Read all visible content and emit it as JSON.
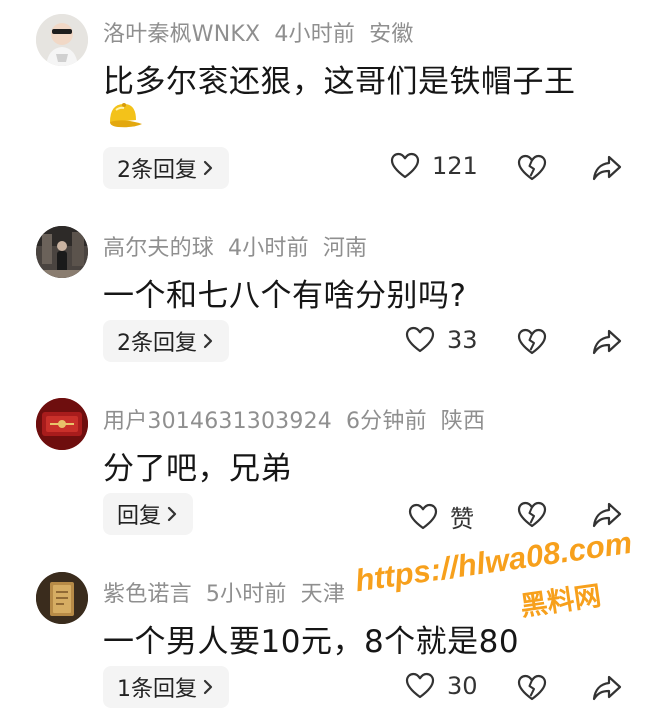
{
  "comments": [
    {
      "user": "洛叶秦枫WNKX",
      "time": "4小时前",
      "location": "安徽",
      "text": "比多尔衮还狠，这哥们是铁帽子王",
      "emoji": "cap-icon",
      "reply_label": "2条回复",
      "likes": "121"
    },
    {
      "user": "高尔夫的球",
      "time": "4小时前",
      "location": "河南",
      "text": "一个和七八个有啥分别吗?",
      "reply_label": "2条回复",
      "likes": "33"
    },
    {
      "user": "用户3014631303924",
      "time": "6分钟前",
      "location": "陕西",
      "text": "分了吧，兄弟",
      "reply_label": "回复",
      "likes": "赞"
    },
    {
      "user": "紫色诺言",
      "time": "5小时前",
      "location": "天津",
      "text": "一个男人要10元，8个就是80",
      "reply_label": "1条回复",
      "likes": "30"
    }
  ],
  "icons": {
    "like": "heart-outline-icon",
    "dislike": "broken-heart-icon",
    "share": "share-arrow-icon",
    "reply_chevron": "chevron-right-icon"
  },
  "watermark": {
    "url": "https://hlwa08.com",
    "label": "黑料网"
  },
  "colors": {
    "meta": "#8f8f8f",
    "text": "#161616",
    "reply_bg": "#f4f4f4",
    "watermark_fill": "#f7a01c"
  }
}
